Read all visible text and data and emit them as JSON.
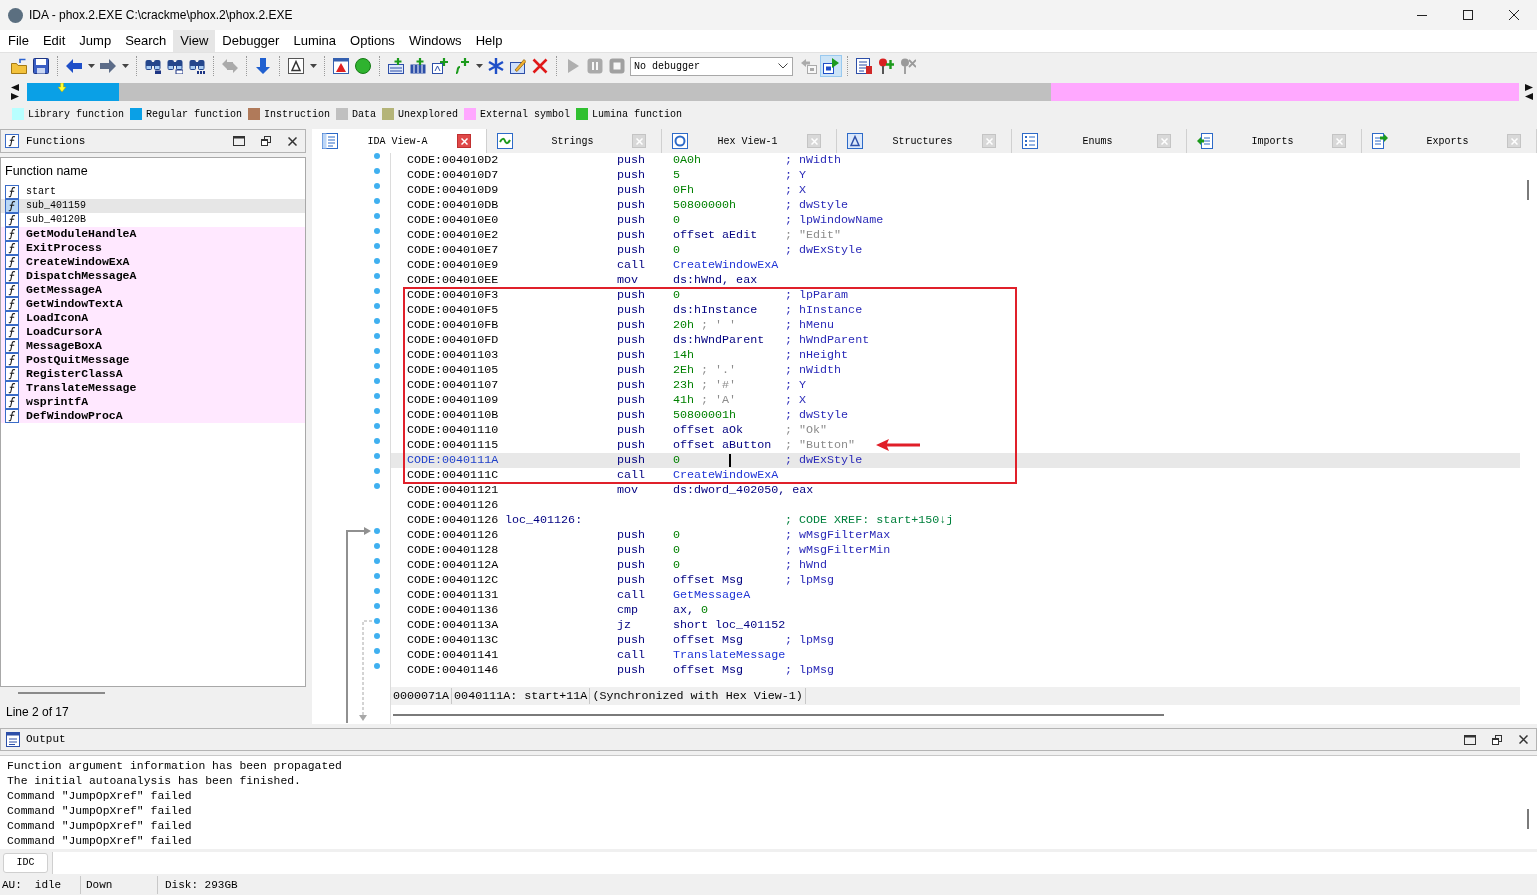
{
  "window": {
    "title": "IDA - phox.2.EXE C:\\crackme\\phox.2\\phox.2.EXE"
  },
  "menu": [
    {
      "label": "File",
      "highlighted": false
    },
    {
      "label": "Edit",
      "highlighted": false
    },
    {
      "label": "Jump",
      "highlighted": false
    },
    {
      "label": "Search",
      "highlighted": false
    },
    {
      "label": "View",
      "highlighted": true
    },
    {
      "label": "Debugger",
      "highlighted": false
    },
    {
      "label": "Lumina",
      "highlighted": false
    },
    {
      "label": "Options",
      "highlighted": false
    },
    {
      "label": "Windows",
      "highlighted": false
    },
    {
      "label": "Help",
      "highlighted": false
    }
  ],
  "toolbar": [
    {
      "kind": "open",
      "disabled": false,
      "pressed": false
    },
    {
      "kind": "save",
      "disabled": false,
      "pressed": false
    },
    {
      "kind": "separator"
    },
    {
      "kind": "back",
      "disabled": false,
      "pressed": false,
      "menu": true
    },
    {
      "kind": "forward",
      "disabled": false,
      "pressed": false,
      "menu": true
    },
    {
      "kind": "separator"
    },
    {
      "kind": "search_bytes",
      "disabled": false,
      "pressed": false
    },
    {
      "kind": "search_text",
      "disabled": false,
      "pressed": false
    },
    {
      "kind": "search_immediate",
      "disabled": false,
      "pressed": false
    },
    {
      "kind": "separator"
    },
    {
      "kind": "jump_pair",
      "disabled": true,
      "pressed": false
    },
    {
      "kind": "separator"
    },
    {
      "kind": "jump_down",
      "disabled": false,
      "pressed": false
    },
    {
      "kind": "separator"
    },
    {
      "kind": "text_style",
      "disabled": false,
      "pressed": false,
      "menu": true
    },
    {
      "kind": "separator"
    },
    {
      "kind": "warning_window",
      "disabled": false,
      "pressed": false
    },
    {
      "kind": "circle",
      "disabled": false,
      "pressed": false
    },
    {
      "kind": "separator"
    },
    {
      "kind": "add_code",
      "disabled": false,
      "pressed": false
    },
    {
      "kind": "add_data",
      "disabled": false,
      "pressed": false
    },
    {
      "kind": "add_text",
      "disabled": false,
      "pressed": false
    },
    {
      "kind": "add_struct",
      "disabled": false,
      "pressed": false,
      "menu": true
    },
    {
      "kind": "asterisk",
      "disabled": false,
      "pressed": false
    },
    {
      "kind": "edit_window",
      "disabled": false,
      "pressed": false
    },
    {
      "kind": "delete",
      "disabled": false,
      "pressed": false
    },
    {
      "kind": "separator"
    },
    {
      "kind": "play",
      "disabled": true,
      "pressed": false
    },
    {
      "kind": "pause",
      "disabled": true,
      "pressed": false
    },
    {
      "kind": "stop",
      "disabled": true,
      "pressed": false
    },
    {
      "kind": "select",
      "value": "No debugger"
    },
    {
      "kind": "attach",
      "disabled": true,
      "pressed": false
    },
    {
      "kind": "run",
      "disabled": false,
      "pressed": true
    },
    {
      "kind": "separator"
    },
    {
      "kind": "doc_list",
      "disabled": false,
      "pressed": false
    },
    {
      "kind": "pin_add",
      "disabled": false,
      "pressed": false
    },
    {
      "kind": "pin_remove",
      "disabled": true,
      "pressed": false
    }
  ],
  "legend": [
    {
      "label": "Library function",
      "color": "#b8ffff"
    },
    {
      "label": "Regular function",
      "color": "#0aa0e6"
    },
    {
      "label": "Instruction",
      "color": "#b07a5a"
    },
    {
      "label": "Data",
      "color": "#c0c0c0"
    },
    {
      "label": "Unexplored",
      "color": "#b4b478"
    },
    {
      "label": "External symbol",
      "color": "#ffa8ff"
    },
    {
      "label": "Lumina function",
      "color": "#30c030"
    }
  ],
  "functions_panel": {
    "title": "Functions",
    "column": "Function name",
    "footer": "Line 2 of 17",
    "items": [
      {
        "name": "start",
        "kind": "regular",
        "selected": false
      },
      {
        "name": "sub_401159",
        "kind": "regular",
        "selected": true
      },
      {
        "name": "sub_40120B",
        "kind": "regular",
        "selected": false
      },
      {
        "name": "GetModuleHandleA",
        "kind": "import",
        "selected": false
      },
      {
        "name": "ExitProcess",
        "kind": "import",
        "selected": false
      },
      {
        "name": "CreateWindowExA",
        "kind": "import",
        "selected": false
      },
      {
        "name": "DispatchMessageA",
        "kind": "import",
        "selected": false
      },
      {
        "name": "GetMessageA",
        "kind": "import",
        "selected": false
      },
      {
        "name": "GetWindowTextA",
        "kind": "import",
        "selected": false
      },
      {
        "name": "LoadIconA",
        "kind": "import",
        "selected": false
      },
      {
        "name": "LoadCursorA",
        "kind": "import",
        "selected": false
      },
      {
        "name": "MessageBoxA",
        "kind": "import",
        "selected": false
      },
      {
        "name": "PostQuitMessage",
        "kind": "import",
        "selected": false
      },
      {
        "name": "RegisterClassA",
        "kind": "import",
        "selected": false
      },
      {
        "name": "TranslateMessage",
        "kind": "import",
        "selected": false
      },
      {
        "name": "wsprintfA",
        "kind": "import",
        "selected": false
      },
      {
        "name": "DefWindowProcA",
        "kind": "import",
        "selected": false
      }
    ]
  },
  "tabs": [
    {
      "label": "IDA View-A",
      "kind": "disasm",
      "selected": true
    },
    {
      "label": "Strings",
      "kind": "strings",
      "selected": false
    },
    {
      "label": "Hex View-1",
      "kind": "hex",
      "selected": false
    },
    {
      "label": "Structures",
      "kind": "structures",
      "selected": false
    },
    {
      "label": "Enums",
      "kind": "enums",
      "selected": false
    },
    {
      "label": "Imports",
      "kind": "imports",
      "selected": false
    },
    {
      "label": "Exports",
      "kind": "exports",
      "selected": false
    }
  ],
  "disassembly": {
    "sections": [
      {
        "kind": "plain",
        "rows": [
          {
            "address": "CODE:004010D2",
            "mnemonic": "push",
            "operand": [
              {
                "text": "0A0h",
                "kind": "number"
              }
            ],
            "comment": {
              "text": "; nWidth",
              "kind": "param"
            },
            "selected": false,
            "pointed": false
          },
          {
            "address": "CODE:004010D7",
            "mnemonic": "push",
            "operand": [
              {
                "text": "5",
                "kind": "number"
              }
            ],
            "comment": {
              "text": "; Y",
              "kind": "param"
            },
            "selected": false,
            "pointed": false
          },
          {
            "address": "CODE:004010D9",
            "mnemonic": "push",
            "operand": [
              {
                "text": "0Fh",
                "kind": "number"
              }
            ],
            "comment": {
              "text": "; X",
              "kind": "param"
            },
            "selected": false,
            "pointed": false
          },
          {
            "address": "CODE:004010DB",
            "mnemonic": "push",
            "operand": [
              {
                "text": "50800000h",
                "kind": "number"
              }
            ],
            "comment": {
              "text": "; dwStyle",
              "kind": "param"
            },
            "selected": false,
            "pointed": false
          },
          {
            "address": "CODE:004010E0",
            "mnemonic": "push",
            "operand": [
              {
                "text": "0",
                "kind": "number"
              }
            ],
            "comment": {
              "text": "; lpWindowName",
              "kind": "param"
            },
            "selected": false,
            "pointed": false
          },
          {
            "address": "CODE:004010E2",
            "mnemonic": "push",
            "operand": [
              {
                "text": "offset aEdit",
                "kind": "name"
              }
            ],
            "comment": {
              "text": "; \"Edit\"",
              "kind": "string"
            },
            "selected": false,
            "pointed": false
          },
          {
            "address": "CODE:004010E7",
            "mnemonic": "push",
            "operand": [
              {
                "text": "0",
                "kind": "number"
              }
            ],
            "comment": {
              "text": "; dwExStyle",
              "kind": "param"
            },
            "selected": false,
            "pointed": false
          },
          {
            "address": "CODE:004010E9",
            "mnemonic": "call",
            "operand": [
              {
                "text": "CreateWindowExA",
                "kind": "func"
              }
            ],
            "selected": false,
            "pointed": false
          },
          {
            "address": "CODE:004010EE",
            "mnemonic": "mov",
            "operand": [
              {
                "text": "ds:hWnd, eax",
                "kind": "name"
              }
            ],
            "selected": false,
            "pointed": false
          }
        ]
      },
      {
        "kind": "framed",
        "rows": [
          {
            "address": "CODE:004010F3",
            "mnemonic": "push",
            "operand": [
              {
                "text": "0",
                "kind": "number"
              }
            ],
            "comment": {
              "text": "; lpParam",
              "kind": "param"
            },
            "selected": false,
            "pointed": false
          },
          {
            "address": "CODE:004010F5",
            "mnemonic": "push",
            "operand": [
              {
                "text": "ds:hInstance",
                "kind": "name"
              }
            ],
            "comment": {
              "text": "; hInstance",
              "kind": "param"
            },
            "selected": false,
            "pointed": false
          },
          {
            "address": "CODE:004010FB",
            "mnemonic": "push",
            "operand": [
              {
                "text": "20h",
                "kind": "number"
              },
              {
                "text": "; ' '",
                "kind": "note"
              }
            ],
            "comment": {
              "text": "; hMenu",
              "kind": "param"
            },
            "selected": false,
            "pointed": false
          },
          {
            "address": "CODE:004010FD",
            "mnemonic": "push",
            "operand": [
              {
                "text": "ds:hWndParent",
                "kind": "name"
              }
            ],
            "comment": {
              "text": "; hWndParent",
              "kind": "param"
            },
            "selected": false,
            "pointed": false
          },
          {
            "address": "CODE:00401103",
            "mnemonic": "push",
            "operand": [
              {
                "text": "14h",
                "kind": "number"
              }
            ],
            "comment": {
              "text": "; nHeight",
              "kind": "param"
            },
            "selected": false,
            "pointed": false
          },
          {
            "address": "CODE:00401105",
            "mnemonic": "push",
            "operand": [
              {
                "text": "2Eh",
                "kind": "number"
              },
              {
                "text": "; '.'",
                "kind": "note"
              }
            ],
            "comment": {
              "text": "; nWidth",
              "kind": "param"
            },
            "selected": false,
            "pointed": false
          },
          {
            "address": "CODE:00401107",
            "mnemonic": "push",
            "operand": [
              {
                "text": "23h",
                "kind": "number"
              },
              {
                "text": "; '#'",
                "kind": "note"
              }
            ],
            "comment": {
              "text": "; Y",
              "kind": "param"
            },
            "selected": false,
            "pointed": false
          },
          {
            "address": "CODE:00401109",
            "mnemonic": "push",
            "operand": [
              {
                "text": "41h",
                "kind": "number"
              },
              {
                "text": "; 'A'",
                "kind": "note"
              }
            ],
            "comment": {
              "text": "; X",
              "kind": "param"
            },
            "selected": false,
            "pointed": false
          },
          {
            "address": "CODE:0040110B",
            "mnemonic": "push",
            "operand": [
              {
                "text": "50800001h",
                "kind": "number"
              }
            ],
            "comment": {
              "text": "; dwStyle",
              "kind": "param"
            },
            "selected": false,
            "pointed": false
          },
          {
            "address": "CODE:00401110",
            "mnemonic": "push",
            "operand": [
              {
                "text": "offset aOk",
                "kind": "name"
              }
            ],
            "comment": {
              "text": "; \"Ok\"",
              "kind": "string"
            },
            "selected": false,
            "pointed": false
          },
          {
            "address": "CODE:00401115",
            "mnemonic": "push",
            "operand": [
              {
                "text": "offset aButton",
                "kind": "name"
              }
            ],
            "comment": {
              "text": "; \"Button\"",
              "kind": "string"
            },
            "selected": false,
            "pointed": true
          },
          {
            "address": "CODE:0040111A",
            "mnemonic": "push",
            "operand": [
              {
                "text": "0",
                "kind": "number"
              }
            ],
            "comment": {
              "text": "; dwExStyle",
              "kind": "param"
            },
            "selected": true,
            "pointed": false
          },
          {
            "address": "CODE:0040111C",
            "mnemonic": "call",
            "operand": [
              {
                "text": "CreateWindowExA",
                "kind": "func"
              }
            ],
            "selected": false,
            "pointed": false
          }
        ]
      },
      {
        "kind": "plain",
        "rows": [
          {
            "address": "CODE:00401121",
            "mnemonic": "mov",
            "operand": [
              {
                "text": "ds:dword_402050, eax",
                "kind": "name"
              }
            ],
            "selected": false,
            "pointed": false
          },
          {
            "address": "CODE:00401126",
            "selected": false,
            "pointed": false
          },
          {
            "address": "CODE:00401126",
            "label": "loc_401126:",
            "comment": {
              "text": "; CODE XREF: start+150↓j",
              "kind": "xref"
            },
            "selected": false,
            "pointed": false
          },
          {
            "address": "CODE:00401126",
            "mnemonic": "push",
            "operand": [
              {
                "text": "0",
                "kind": "number"
              }
            ],
            "comment": {
              "text": "; wMsgFilterMax",
              "kind": "param"
            },
            "selected": false,
            "pointed": false,
            "jump": {
              "kind": "incoming"
            }
          },
          {
            "address": "CODE:00401128",
            "mnemonic": "push",
            "operand": [
              {
                "text": "0",
                "kind": "number"
              }
            ],
            "comment": {
              "text": "; wMsgFilterMin",
              "kind": "param"
            },
            "selected": false,
            "pointed": false
          },
          {
            "address": "CODE:0040112A",
            "mnemonic": "push",
            "operand": [
              {
                "text": "0",
                "kind": "number"
              }
            ],
            "comment": {
              "text": "; hWnd",
              "kind": "param"
            },
            "selected": false,
            "pointed": false
          },
          {
            "address": "CODE:0040112C",
            "mnemonic": "push",
            "operand": [
              {
                "text": "offset Msg",
                "kind": "name"
              }
            ],
            "comment": {
              "text": "; lpMsg",
              "kind": "param"
            },
            "selected": false,
            "pointed": false
          },
          {
            "address": "CODE:00401131",
            "mnemonic": "call",
            "operand": [
              {
                "text": "GetMessageA",
                "kind": "func"
              }
            ],
            "selected": false,
            "pointed": false
          },
          {
            "address": "CODE:00401136",
            "mnemonic": "cmp",
            "operand": [
              {
                "text": "ax,",
                "kind": "name"
              },
              {
                "text": "0",
                "kind": "number"
              }
            ],
            "selected": false,
            "pointed": false
          },
          {
            "address": "CODE:0040113A",
            "mnemonic": "jz",
            "operand": [
              {
                "text": "short loc_401152",
                "kind": "name"
              }
            ],
            "selected": false,
            "pointed": false,
            "jump": {
              "kind": "outgoing"
            }
          },
          {
            "address": "CODE:0040113C",
            "mnemonic": "push",
            "operand": [
              {
                "text": "offset Msg",
                "kind": "name"
              }
            ],
            "comment": {
              "text": "; lpMsg",
              "kind": "param"
            },
            "selected": false,
            "pointed": false
          },
          {
            "address": "CODE:00401141",
            "mnemonic": "call",
            "operand": [
              {
                "text": "TranslateMessage",
                "kind": "func"
              }
            ],
            "selected": false,
            "pointed": false
          },
          {
            "address": "CODE:00401146",
            "mnemonic": "push",
            "operand": [
              {
                "text": "offset Msg",
                "kind": "name"
              }
            ],
            "comment": {
              "text": "; lpMsg",
              "kind": "param"
            },
            "selected": false,
            "pointed": false
          }
        ]
      }
    ],
    "status": [
      "0000071A",
      "0040111A: start+11A",
      "(Synchronized with Hex View-1)"
    ]
  },
  "output": {
    "title": "Output",
    "lines": [
      "Function argument information has been propagated",
      "The initial autoanalysis has been finished.",
      "Command \"JumpOpXref\" failed",
      "Command \"JumpOpXref\" failed",
      "Command \"JumpOpXref\" failed",
      "Command \"JumpOpXref\" failed"
    ]
  },
  "command": {
    "language": "IDC"
  },
  "status_bar": {
    "label": "AU:",
    "state": "idle",
    "direction": "Down",
    "disk": "Disk: 293GB"
  }
}
